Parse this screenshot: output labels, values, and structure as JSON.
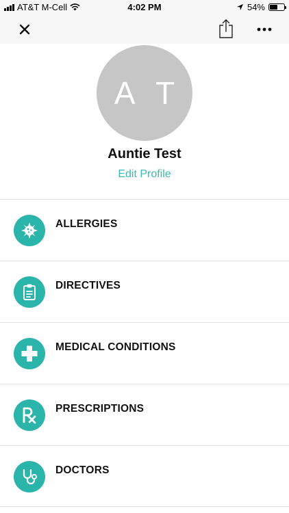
{
  "status_bar": {
    "carrier": "AT&T M-Cell",
    "time": "4:02 PM",
    "battery_percent": "54%",
    "battery_level": 0.54
  },
  "toolbar": {
    "close_icon": "close-icon",
    "share_icon": "share-icon",
    "more_icon": "more-icon"
  },
  "profile": {
    "initials": "A T",
    "name": "Auntie Test",
    "edit_label": "Edit Profile",
    "avatar_color": "#c6c6c6",
    "link_color": "#3ab7ae"
  },
  "menu": {
    "accent_color": "#2bb4a9",
    "items": [
      {
        "label": "ALLERGIES",
        "icon": "allergy-icon"
      },
      {
        "label": "DIRECTIVES",
        "icon": "clipboard-icon"
      },
      {
        "label": "MEDICAL CONDITIONS",
        "icon": "medical-cross-icon"
      },
      {
        "label": "PRESCRIPTIONS",
        "icon": "rx-icon"
      },
      {
        "label": "DOCTORS",
        "icon": "stethoscope-icon"
      }
    ]
  }
}
